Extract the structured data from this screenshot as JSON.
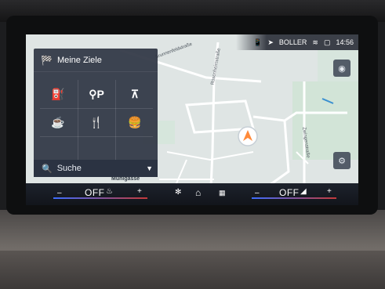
{
  "status_bar": {
    "profile_name": "BOLLER",
    "clock": "14:56",
    "icons": [
      "phone-icon",
      "navigation-arrow-icon",
      "wifi-icon",
      "message-icon"
    ]
  },
  "destinations_panel": {
    "title": "Meine Ziele",
    "title_icon": "checkered-flag-icon",
    "shortcuts": [
      {
        "name": "fuel-station",
        "glyph": "⛽"
      },
      {
        "name": "parking-search",
        "glyph": "⚲P"
      },
      {
        "name": "picnic-area",
        "glyph": "⊼"
      },
      {
        "name": "cafe",
        "glyph": "☕"
      },
      {
        "name": "restaurant",
        "glyph": "🍴"
      },
      {
        "name": "fast-food",
        "glyph": "🍔"
      }
    ],
    "search_label": "Suche",
    "search_icon": "magnifier-icon"
  },
  "map": {
    "streets": [
      "Brunnenfeldstraße",
      "Rosenheimstraße",
      "Zwingenstraße",
      "Mühlgasse"
    ],
    "colors": {
      "land": "#dfe5e4",
      "road": "#ffffff",
      "park": "#cfe4d6",
      "accent": "#ff8a3a"
    }
  },
  "climate_bar": {
    "left_minus": "–",
    "left_temp": "OFF",
    "left_plus": "+",
    "right_minus": "–",
    "right_temp": "OFF",
    "right_plus": "+",
    "fan_icon": "fan-icon",
    "home_icon": "home-icon",
    "apps_icon": "apps-grid-icon"
  }
}
